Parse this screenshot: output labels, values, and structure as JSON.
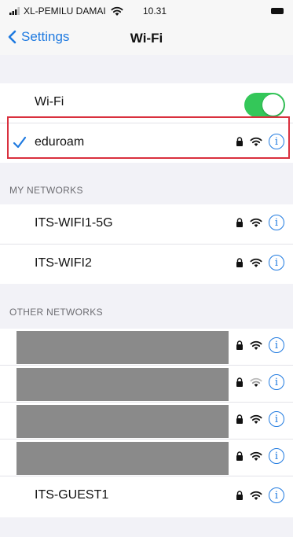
{
  "status_bar": {
    "carrier": "XL-PEMILU DAMAI",
    "time": "10.31"
  },
  "nav": {
    "back_label": "Settings",
    "title": "Wi-Fi"
  },
  "wifi_toggle": {
    "label": "Wi-Fi",
    "on": true,
    "color": "#34c759"
  },
  "connected_network": {
    "name": "eduroam",
    "secured": true
  },
  "my_networks": {
    "header": "MY NETWORKS",
    "items": [
      {
        "name": "ITS-WIFI1-5G",
        "secured": true
      },
      {
        "name": "ITS-WIFI2",
        "secured": true
      }
    ]
  },
  "other_networks": {
    "header": "OTHER NETWORKS",
    "items": [
      {
        "name": "",
        "redacted": true,
        "secured": true
      },
      {
        "name": "",
        "redacted": true,
        "secured": true
      },
      {
        "name": "",
        "redacted": true,
        "secured": true
      },
      {
        "name": "",
        "redacted": true,
        "secured": true
      },
      {
        "name": "ITS-GUEST1",
        "secured": true
      }
    ]
  },
  "icons": {
    "check": "checkmark-icon",
    "lock": "lock-icon",
    "wifi": "wifi-icon",
    "info": "info-icon",
    "info_glyph": "i"
  },
  "colors": {
    "accent": "#1f7ae0",
    "highlight": "#d9303e"
  }
}
